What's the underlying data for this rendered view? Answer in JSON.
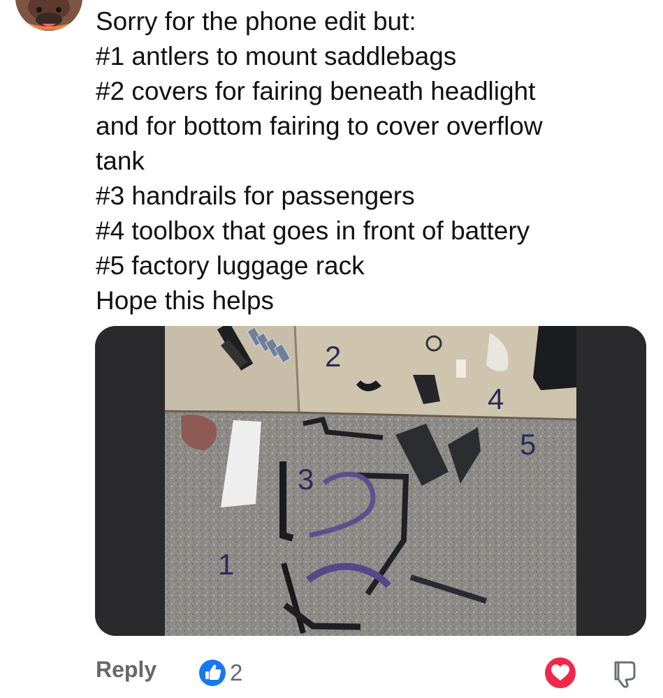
{
  "comment": {
    "lines": [
      "Sorry for the phone edit but:",
      "#1 antlers to mount saddlebags",
      "#2 covers for fairing beneath headlight",
      "and for bottom fairing to cover overflow",
      "tank",
      "#3 handrails for passengers",
      "#4 toolbox that goes in front of battery",
      "#5 factory luggage rack",
      "Hope this helps"
    ]
  },
  "photo": {
    "labels": [
      "1",
      "2",
      "3",
      "4",
      "5"
    ]
  },
  "actions": {
    "reply_label": "Reply",
    "like_count": "2"
  },
  "icons": {
    "avatar": "dog-avatar",
    "like": "thumbs-up-icon",
    "love": "heart-icon",
    "dislike": "thumbs-down-icon"
  },
  "colors": {
    "like_blue": "#1877f2",
    "love_red": "#f0284a",
    "meta_gray": "#65676b",
    "label_navy": "#2d2a5a"
  }
}
